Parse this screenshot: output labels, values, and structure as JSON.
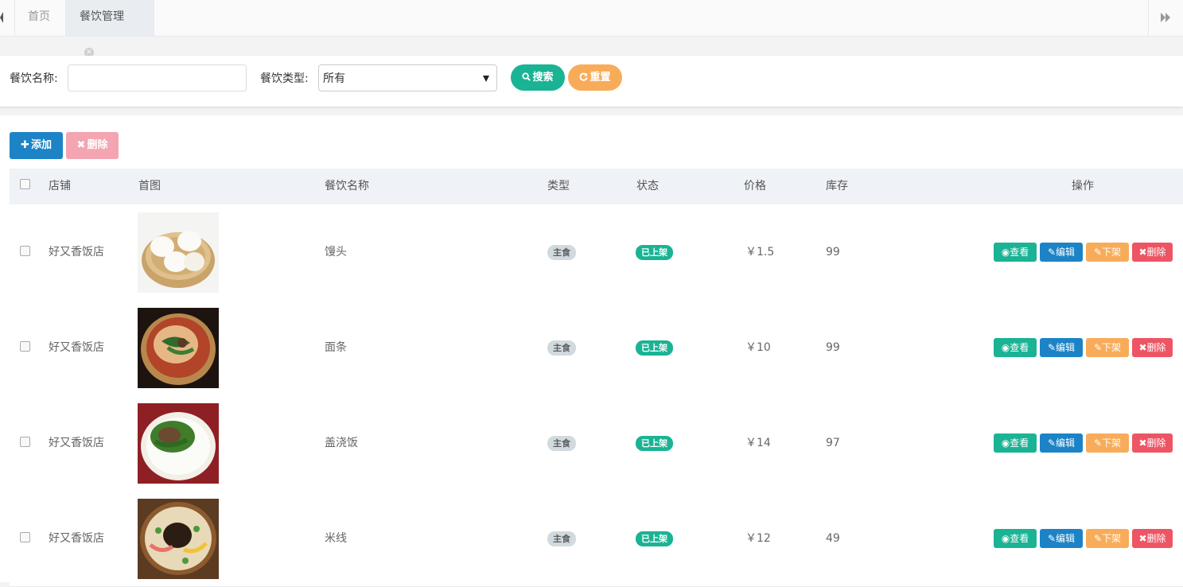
{
  "tabs": {
    "home_label": "首页",
    "active_label": "餐饮管理",
    "close_symbol": "⊗"
  },
  "search": {
    "name_label": "餐饮名称:",
    "name_value": "",
    "type_label": "餐饮类型:",
    "type_value": "所有",
    "search_button": "搜索",
    "reset_button": "重置"
  },
  "toolbar": {
    "add_button": "添加",
    "delete_button": "删除"
  },
  "table": {
    "columns": [
      "店铺",
      "首图",
      "餐饮名称",
      "类型",
      "状态",
      "价格",
      "库存",
      "操作"
    ],
    "actions": {
      "view": "查看",
      "edit": "编辑",
      "off": "下架",
      "delete": "删除"
    },
    "rows": [
      {
        "shop": "好又香饭店",
        "image": "steamed-buns",
        "name": "馒头",
        "type": "主食",
        "status": "已上架",
        "price": "￥1.5",
        "stock": "99"
      },
      {
        "shop": "好又香饭店",
        "image": "noodles",
        "name": "面条",
        "type": "主食",
        "status": "已上架",
        "price": "￥10",
        "stock": "99"
      },
      {
        "shop": "好又香饭店",
        "image": "rice-bowl",
        "name": "盖浇饭",
        "type": "主食",
        "status": "已上架",
        "price": "￥14",
        "stock": "97"
      },
      {
        "shop": "好又香饭店",
        "image": "rice-noodles",
        "name": "米线",
        "type": "主食",
        "status": "已上架",
        "price": "￥12",
        "stock": "49"
      }
    ]
  },
  "colors": {
    "primary": "#1ab394",
    "info": "#1c84c6",
    "warning": "#f8ac59",
    "danger": "#ed5565"
  }
}
